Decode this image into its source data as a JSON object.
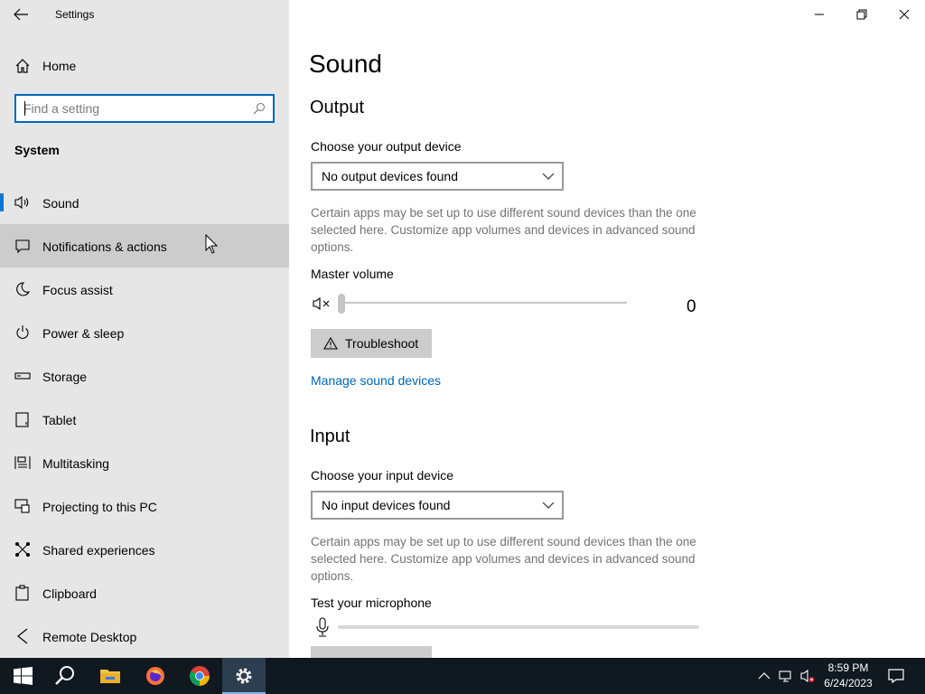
{
  "window": {
    "title": "Settings"
  },
  "sidebar": {
    "home_label": "Home",
    "search_placeholder": "Find a setting",
    "section_heading": "System",
    "items": [
      {
        "label": "Sound",
        "icon": "speaker-icon",
        "selected": true
      },
      {
        "label": "Notifications & actions",
        "icon": "notifications-icon",
        "hovered": true
      },
      {
        "label": "Focus assist",
        "icon": "moon-icon"
      },
      {
        "label": "Power & sleep",
        "icon": "power-icon"
      },
      {
        "label": "Storage",
        "icon": "storage-icon"
      },
      {
        "label": "Tablet",
        "icon": "tablet-icon"
      },
      {
        "label": "Multitasking",
        "icon": "multitasking-icon"
      },
      {
        "label": "Projecting to this PC",
        "icon": "projecting-icon"
      },
      {
        "label": "Shared experiences",
        "icon": "shared-experiences-icon"
      },
      {
        "label": "Clipboard",
        "icon": "clipboard-icon"
      },
      {
        "label": "Remote Desktop",
        "icon": "remote-desktop-icon"
      }
    ]
  },
  "main": {
    "title": "Sound",
    "output": {
      "heading": "Output",
      "choose_label": "Choose your output device",
      "device_value": "No output devices found",
      "description": "Certain apps may be set up to use different sound devices than the one selected here. Customize app volumes and devices in advanced sound options.",
      "master_volume_label": "Master volume",
      "volume_value": "0",
      "troubleshoot_label": "Troubleshoot",
      "manage_link": "Manage sound devices"
    },
    "input": {
      "heading": "Input",
      "choose_label": "Choose your input device",
      "device_value": "No input devices found",
      "description": "Certain apps may be set up to use different sound devices than the one selected here. Customize app volumes and devices in advanced sound options.",
      "test_mic_label": "Test your microphone"
    }
  },
  "taskbar": {
    "items": [
      "start-icon",
      "search-icon",
      "file-explorer-icon",
      "firefox-icon",
      "chrome-icon",
      "settings-icon"
    ],
    "time": "8:59 PM",
    "date": "6/24/2023",
    "colors": {
      "background": "#101820",
      "active": "#2d3e50",
      "accent": "#0078d7"
    }
  }
}
